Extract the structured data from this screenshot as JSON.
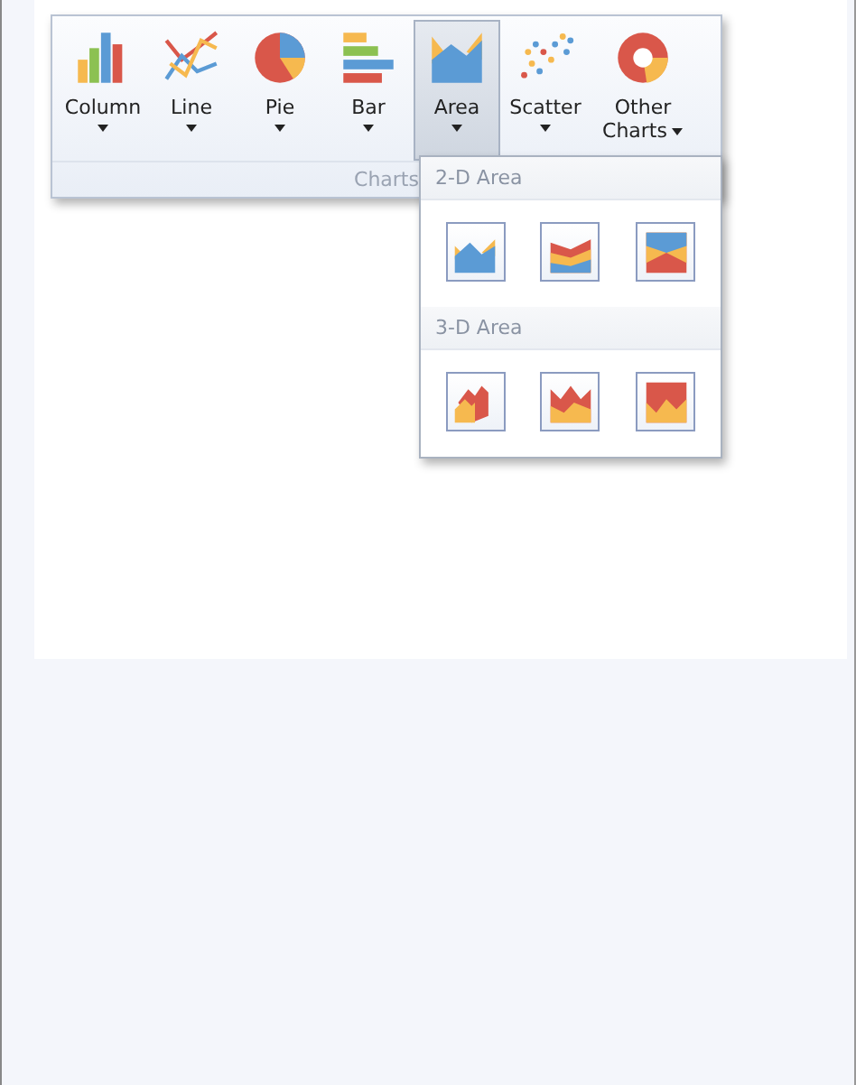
{
  "ribbon": {
    "buttons": [
      {
        "kind": "column",
        "label": "Column",
        "selected": false
      },
      {
        "kind": "line",
        "label": "Line",
        "selected": false
      },
      {
        "kind": "pie",
        "label": "Pie",
        "selected": false
      },
      {
        "kind": "bar",
        "label": "Bar",
        "selected": false
      },
      {
        "kind": "area",
        "label": "Area",
        "selected": true
      },
      {
        "kind": "scatter",
        "label": "Scatter",
        "selected": false
      },
      {
        "kind": "other",
        "label": "Other Charts",
        "selected": false
      }
    ],
    "group_label": "Charts"
  },
  "dropdown": {
    "sections": [
      {
        "title": "2-D Area",
        "items": [
          {
            "kind": "area"
          },
          {
            "kind": "stacked"
          },
          {
            "kind": "full-stacked"
          }
        ]
      },
      {
        "title": "3-D Area",
        "items": [
          {
            "kind": "area3d"
          },
          {
            "kind": "stacked3d"
          },
          {
            "kind": "full-stacked3d"
          }
        ]
      }
    ]
  }
}
